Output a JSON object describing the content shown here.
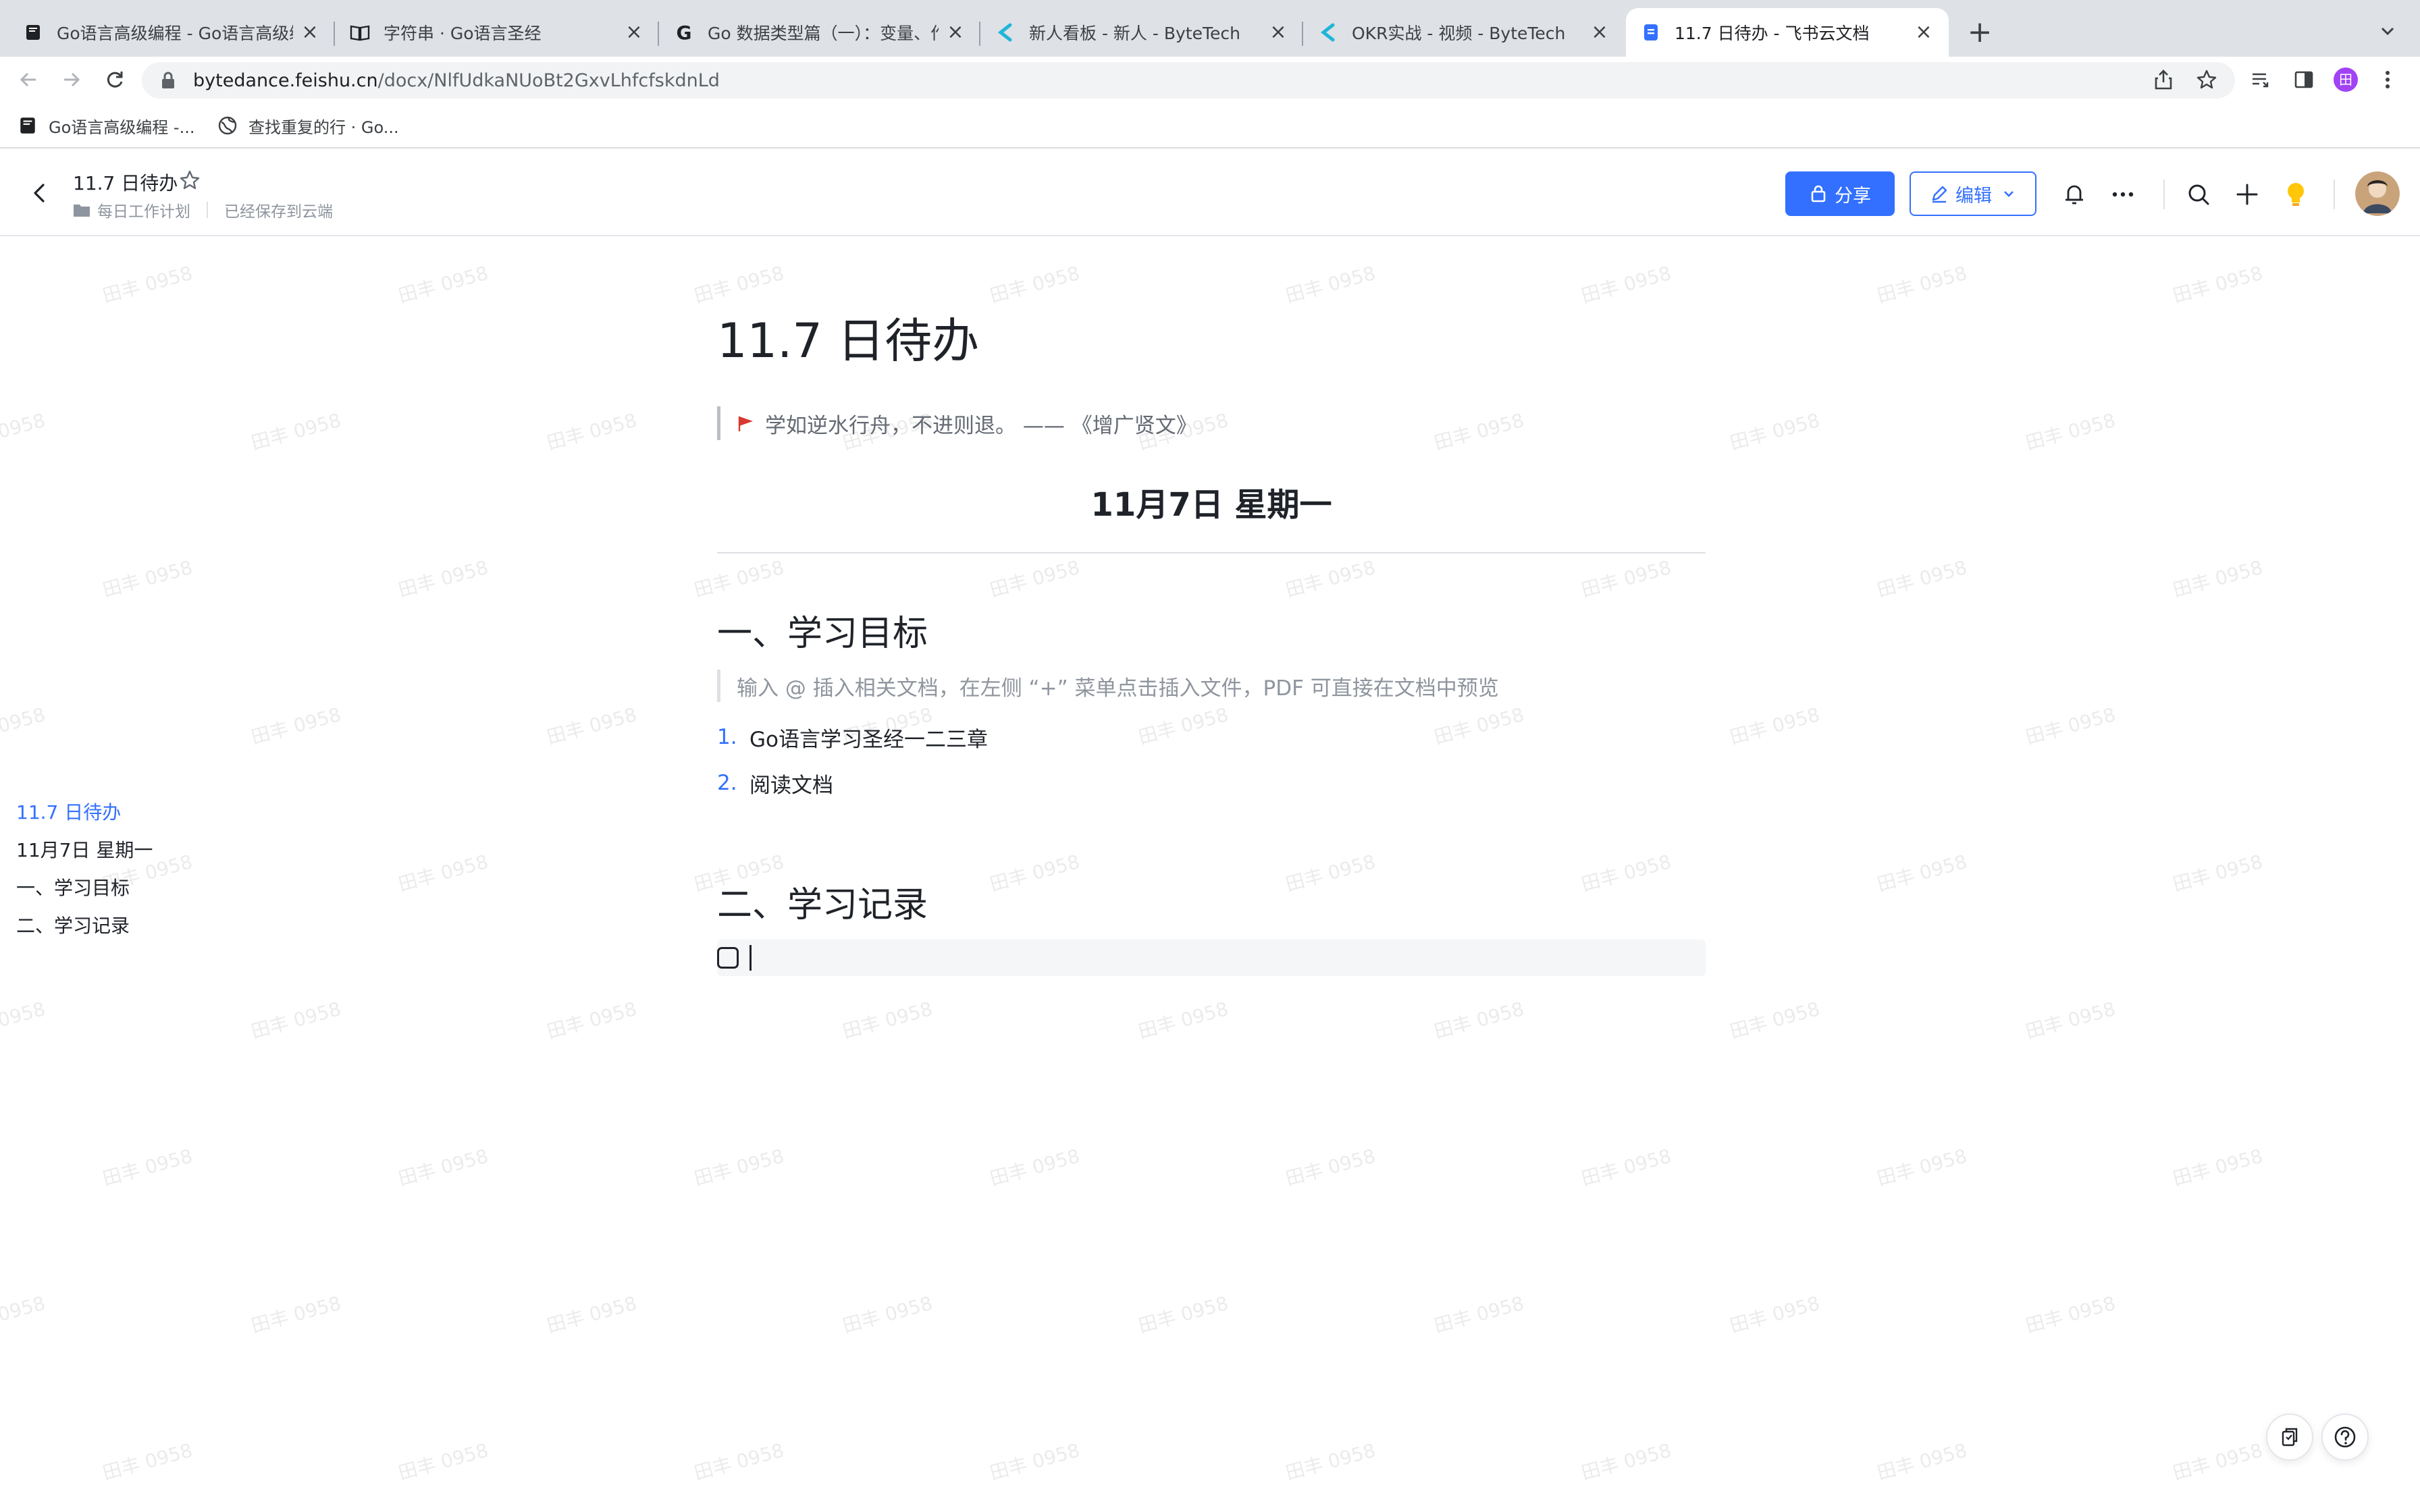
{
  "browser": {
    "tabs": [
      {
        "title": "Go语言高级编程 - Go语言高级编",
        "favicon": "book-icon"
      },
      {
        "title": "字符串 · Go语言圣经",
        "favicon": "open-book-icon"
      },
      {
        "title": "Go 数据类型篇（一）：变量、作",
        "favicon": "g-logo-icon"
      },
      {
        "title": "新人看板 - 新人 - ByteTech",
        "favicon": "bytetech-icon"
      },
      {
        "title": "OKR实战 - 视频 - ByteTech",
        "favicon": "bytetech-icon"
      },
      {
        "title": "11.7 日待办 - 飞书云文档",
        "favicon": "doc-icon"
      }
    ],
    "active_tab": 5,
    "url_host": "bytedance.feishu.cn",
    "url_path": "/docx/NlfUdkaNUoBt2GxvLhfcfskdnLd",
    "bookmarks": [
      {
        "label": "Go语言高级编程 -...",
        "icon": "book-icon"
      },
      {
        "label": "查找重复的行 · Go...",
        "icon": "globe-icon"
      }
    ],
    "profile_initial": "田"
  },
  "header": {
    "doc_title": "11.7 日待办",
    "folder": "每日工作计划",
    "save_status": "已经保存到云端",
    "share_label": "分享",
    "edit_label": "编辑"
  },
  "watermark": "田丰 0958",
  "toc": {
    "items": [
      {
        "label": "11.7 日待办",
        "active": true
      },
      {
        "label": "11月7日 星期一",
        "active": false
      },
      {
        "label": "一、学习目标",
        "active": false
      },
      {
        "label": "二、学习记录",
        "active": false
      }
    ]
  },
  "doc": {
    "title": "11.7 日待办",
    "quote": "学如逆水行舟，不进则退。 —— 《增广贤文》",
    "date_heading": "11月7日 星期一",
    "section1": "一、学习目标",
    "hint": "输入 @ 插入相关文档，在左侧 “+” 菜单点击插入文件，PDF 可直接在文档中预览",
    "list": [
      {
        "num": "1.",
        "text": "Go语言学习圣经一二三章"
      },
      {
        "num": "2.",
        "text": "阅读文档"
      }
    ],
    "section2": "二、学习记录"
  },
  "colors": {
    "accent": "#3370ff",
    "text": "#1f2329",
    "muted": "#8f959e",
    "flag": "#d83931"
  }
}
